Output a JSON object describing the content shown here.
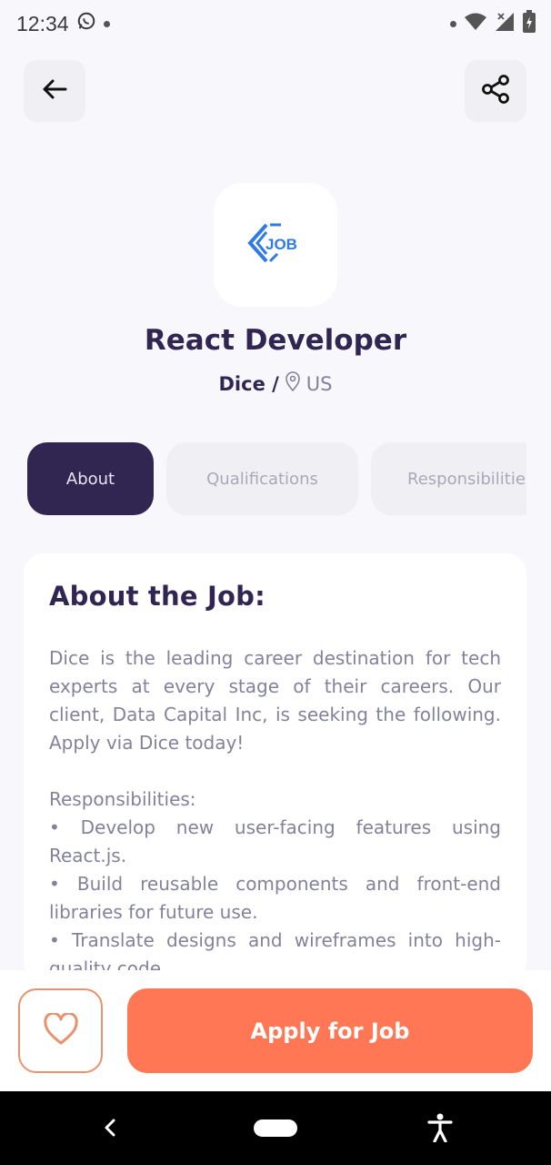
{
  "status_bar": {
    "time": "12:34",
    "icons": [
      "whatsapp-icon",
      "wifi-icon",
      "signal-icon",
      "battery-charging-icon"
    ]
  },
  "header": {
    "back_icon": "arrow-left-icon",
    "share_icon": "share-icon"
  },
  "job": {
    "logo_text": "JOB",
    "title": "React Developer",
    "company": "Dice /",
    "location": "US"
  },
  "tabs": [
    {
      "label": "About",
      "active": true
    },
    {
      "label": "Qualifications",
      "active": false
    },
    {
      "label": "Responsibilities",
      "active": false
    }
  ],
  "about": {
    "heading": "About the Job:",
    "paragraph_1": "Dice is the leading career destination for tech experts at every stage of their careers. Our client, Data Capital Inc, is seeking the following. Apply via Dice today!",
    "paragraph_2_title": "Responsibilities:",
    "bullets": [
      "• Develop new user-facing features using React.js.",
      "• Build reusable components and front-end libraries for future use.",
      "• Translate designs and wireframes into high-quality code."
    ]
  },
  "footer": {
    "favorite_icon": "heart-icon",
    "apply_label": "Apply for Job"
  },
  "colors": {
    "primary": "#312651",
    "accent": "#FF7754",
    "background": "#F8F8FC",
    "muted": "#83829A"
  }
}
